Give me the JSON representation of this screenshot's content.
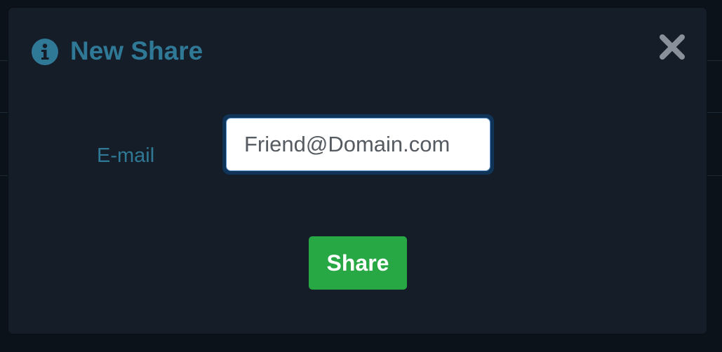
{
  "dialog": {
    "title": "New Share",
    "title_icon": "info-circle-icon",
    "close_icon": "close-x-icon"
  },
  "form": {
    "email_label": "E-mail",
    "email_value": "",
    "email_placeholder": "Friend@Domain.com"
  },
  "actions": {
    "share_label": "Share"
  },
  "colors": {
    "accent": "#2f7896",
    "modal_bg": "#151d28",
    "page_bg": "#0c1219",
    "share_button": "#28a745",
    "close_icon": "#8a9099"
  }
}
